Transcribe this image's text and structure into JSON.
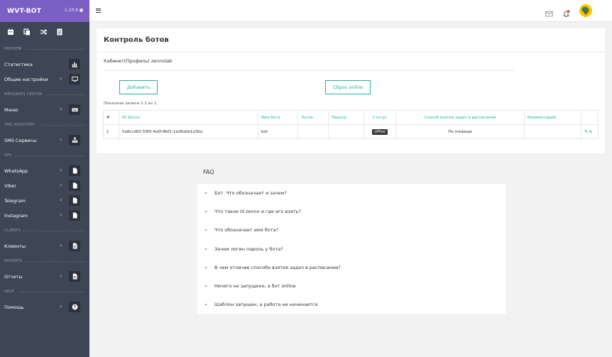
{
  "app": {
    "logo": "WVT-BOT",
    "version": "1.10.9"
  },
  "colors": {
    "accent": "#1fb2a6",
    "brand": "#7b5fc3",
    "sidebar": "#3e4655"
  },
  "quick_icons": [
    "calendar-icon",
    "copy-icon",
    "shuffle-icon",
    "document-icon"
  ],
  "sidebar": {
    "preview": "PREVIEW",
    "statistics": "Статистика",
    "general_settings": "Общие настройки",
    "messages_center": "MESSAGES CENTER",
    "menu": "Меню",
    "sms_assistent": "SMS ASSISTENT",
    "sms_services": "SMS Сервисы",
    "apk": "APK",
    "whatsapp": "WhatsApp",
    "viber": "Viber",
    "telegram": "Telegram",
    "instagram": "Instagram",
    "clients_section": "CLIENTS",
    "clients": "Клиенты",
    "reports_section": "REPORTS",
    "reports": "Отчеты",
    "help_section": "HELP",
    "help": "Помощь"
  },
  "main": {
    "title": "Контроль ботов",
    "subtitle": "Кабинет(Профиль) zennolab",
    "add_button": "Добавить",
    "reset_button": "Сброс online",
    "shown": "Показаны записи 1-1 из 1.",
    "columns": [
      "#",
      "ID Zenno",
      "Имя бота",
      "Логин",
      "Пароль",
      "Статус",
      "Способ взятия задач в расписании",
      "Комментарий"
    ],
    "rows": [
      {
        "num": "1",
        "id": "5a8ccd82-59f0-4a0f-8bf2-1ad6a0b1a3ba",
        "name": "bot",
        "login": "",
        "password": "",
        "status": "offline",
        "method": "По очереди",
        "comment": ""
      }
    ]
  },
  "faq": {
    "title": "FAQ",
    "items": [
      "Бот. Что обозначает и зачем?",
      "Что такое id zenno и где его взять?",
      "Что обозначает имя бота?",
      "Зачем логин пароль у бота?",
      "В чем отличие способа взятия задач в расписании?",
      "Ничего не запущено, а бот online",
      "Шаблон запущен, а работа не начинается"
    ]
  }
}
